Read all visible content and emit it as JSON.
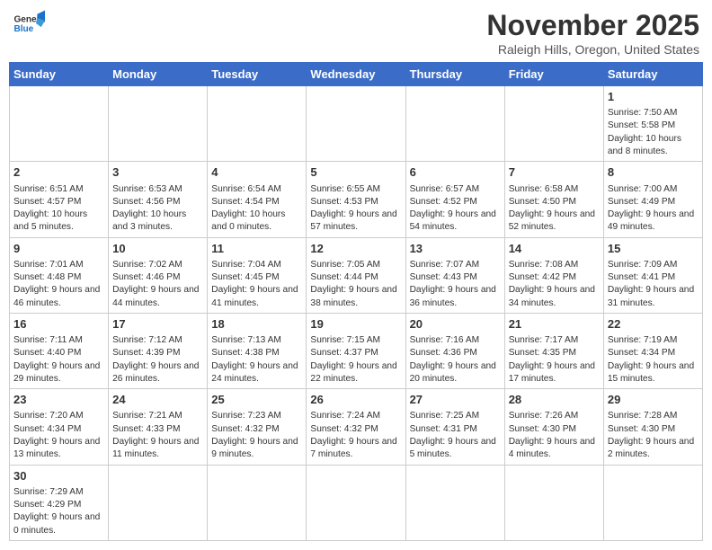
{
  "header": {
    "logo_general": "General",
    "logo_blue": "Blue",
    "month_title": "November 2025",
    "subtitle": "Raleigh Hills, Oregon, United States"
  },
  "weekdays": [
    "Sunday",
    "Monday",
    "Tuesday",
    "Wednesday",
    "Thursday",
    "Friday",
    "Saturday"
  ],
  "weeks": [
    [
      {
        "day": "",
        "content": ""
      },
      {
        "day": "",
        "content": ""
      },
      {
        "day": "",
        "content": ""
      },
      {
        "day": "",
        "content": ""
      },
      {
        "day": "",
        "content": ""
      },
      {
        "day": "",
        "content": ""
      },
      {
        "day": "1",
        "content": "Sunrise: 7:50 AM\nSunset: 5:58 PM\nDaylight: 10 hours and 8 minutes."
      }
    ],
    [
      {
        "day": "2",
        "content": "Sunrise: 6:51 AM\nSunset: 4:57 PM\nDaylight: 10 hours and 5 minutes."
      },
      {
        "day": "3",
        "content": "Sunrise: 6:53 AM\nSunset: 4:56 PM\nDaylight: 10 hours and 3 minutes."
      },
      {
        "day": "4",
        "content": "Sunrise: 6:54 AM\nSunset: 4:54 PM\nDaylight: 10 hours and 0 minutes."
      },
      {
        "day": "5",
        "content": "Sunrise: 6:55 AM\nSunset: 4:53 PM\nDaylight: 9 hours and 57 minutes."
      },
      {
        "day": "6",
        "content": "Sunrise: 6:57 AM\nSunset: 4:52 PM\nDaylight: 9 hours and 54 minutes."
      },
      {
        "day": "7",
        "content": "Sunrise: 6:58 AM\nSunset: 4:50 PM\nDaylight: 9 hours and 52 minutes."
      },
      {
        "day": "8",
        "content": "Sunrise: 7:00 AM\nSunset: 4:49 PM\nDaylight: 9 hours and 49 minutes."
      }
    ],
    [
      {
        "day": "9",
        "content": "Sunrise: 7:01 AM\nSunset: 4:48 PM\nDaylight: 9 hours and 46 minutes."
      },
      {
        "day": "10",
        "content": "Sunrise: 7:02 AM\nSunset: 4:46 PM\nDaylight: 9 hours and 44 minutes."
      },
      {
        "day": "11",
        "content": "Sunrise: 7:04 AM\nSunset: 4:45 PM\nDaylight: 9 hours and 41 minutes."
      },
      {
        "day": "12",
        "content": "Sunrise: 7:05 AM\nSunset: 4:44 PM\nDaylight: 9 hours and 38 minutes."
      },
      {
        "day": "13",
        "content": "Sunrise: 7:07 AM\nSunset: 4:43 PM\nDaylight: 9 hours and 36 minutes."
      },
      {
        "day": "14",
        "content": "Sunrise: 7:08 AM\nSunset: 4:42 PM\nDaylight: 9 hours and 34 minutes."
      },
      {
        "day": "15",
        "content": "Sunrise: 7:09 AM\nSunset: 4:41 PM\nDaylight: 9 hours and 31 minutes."
      }
    ],
    [
      {
        "day": "16",
        "content": "Sunrise: 7:11 AM\nSunset: 4:40 PM\nDaylight: 9 hours and 29 minutes."
      },
      {
        "day": "17",
        "content": "Sunrise: 7:12 AM\nSunset: 4:39 PM\nDaylight: 9 hours and 26 minutes."
      },
      {
        "day": "18",
        "content": "Sunrise: 7:13 AM\nSunset: 4:38 PM\nDaylight: 9 hours and 24 minutes."
      },
      {
        "day": "19",
        "content": "Sunrise: 7:15 AM\nSunset: 4:37 PM\nDaylight: 9 hours and 22 minutes."
      },
      {
        "day": "20",
        "content": "Sunrise: 7:16 AM\nSunset: 4:36 PM\nDaylight: 9 hours and 20 minutes."
      },
      {
        "day": "21",
        "content": "Sunrise: 7:17 AM\nSunset: 4:35 PM\nDaylight: 9 hours and 17 minutes."
      },
      {
        "day": "22",
        "content": "Sunrise: 7:19 AM\nSunset: 4:34 PM\nDaylight: 9 hours and 15 minutes."
      }
    ],
    [
      {
        "day": "23",
        "content": "Sunrise: 7:20 AM\nSunset: 4:34 PM\nDaylight: 9 hours and 13 minutes."
      },
      {
        "day": "24",
        "content": "Sunrise: 7:21 AM\nSunset: 4:33 PM\nDaylight: 9 hours and 11 minutes."
      },
      {
        "day": "25",
        "content": "Sunrise: 7:23 AM\nSunset: 4:32 PM\nDaylight: 9 hours and 9 minutes."
      },
      {
        "day": "26",
        "content": "Sunrise: 7:24 AM\nSunset: 4:32 PM\nDaylight: 9 hours and 7 minutes."
      },
      {
        "day": "27",
        "content": "Sunrise: 7:25 AM\nSunset: 4:31 PM\nDaylight: 9 hours and 5 minutes."
      },
      {
        "day": "28",
        "content": "Sunrise: 7:26 AM\nSunset: 4:30 PM\nDaylight: 9 hours and 4 minutes."
      },
      {
        "day": "29",
        "content": "Sunrise: 7:28 AM\nSunset: 4:30 PM\nDaylight: 9 hours and 2 minutes."
      }
    ],
    [
      {
        "day": "30",
        "content": "Sunrise: 7:29 AM\nSunset: 4:29 PM\nDaylight: 9 hours and 0 minutes."
      },
      {
        "day": "",
        "content": ""
      },
      {
        "day": "",
        "content": ""
      },
      {
        "day": "",
        "content": ""
      },
      {
        "day": "",
        "content": ""
      },
      {
        "day": "",
        "content": ""
      },
      {
        "day": "",
        "content": ""
      }
    ]
  ]
}
